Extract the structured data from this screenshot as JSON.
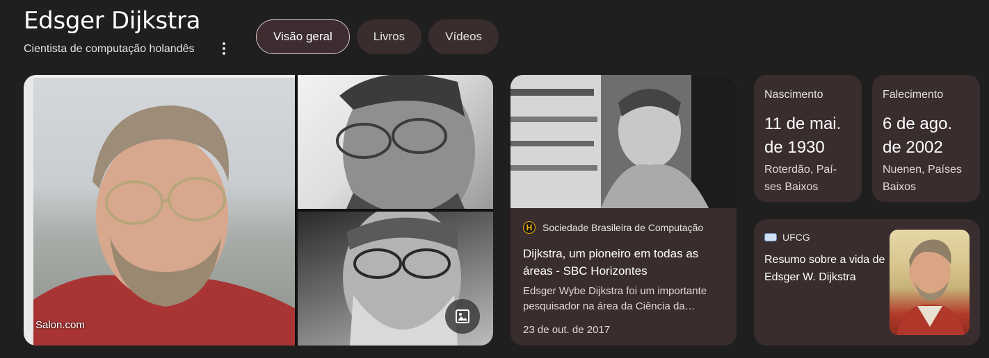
{
  "header": {
    "title": "Edsger Dijkstra",
    "subtitle": "Cientista de computação holandês"
  },
  "tabs": [
    {
      "label": "Visão geral",
      "active": true
    },
    {
      "label": "Livros",
      "active": false
    },
    {
      "label": "Vídeos",
      "active": false
    }
  ],
  "images": {
    "main_caption": "Salon.com",
    "more_images_icon": "image-icon"
  },
  "article": {
    "source": "Sociedade Brasileira de Computação",
    "favicon_letter": "H",
    "title": "Dijkstra, um pioneiro em todas as áreas - SBC Horizontes",
    "snippet": "Edsger Wybe Dijkstra foi um importante pesquisador na área da Ciência da…",
    "date": "23 de out. de 2017"
  },
  "facts": {
    "birth": {
      "label": "Nascimento",
      "date_line1": "11 de mai.",
      "date_line2": "de 1930",
      "place_line1": "Roterdão, Paí-",
      "place_line2": "ses Baixos"
    },
    "death": {
      "label": "Falecimento",
      "date_line1": "6 de ago.",
      "date_line2": "de 2002",
      "place_line1": "Nuenen, Países",
      "place_line2": "Baixos"
    }
  },
  "related": {
    "source": "UFCG",
    "title": "Resumo sobre a vida de Edsger W. Dijkstra"
  },
  "colors": {
    "background": "#1f1f1f",
    "card": "#3a2d2e",
    "chip": "#3a2d2d",
    "text": "#e3e3e3"
  }
}
